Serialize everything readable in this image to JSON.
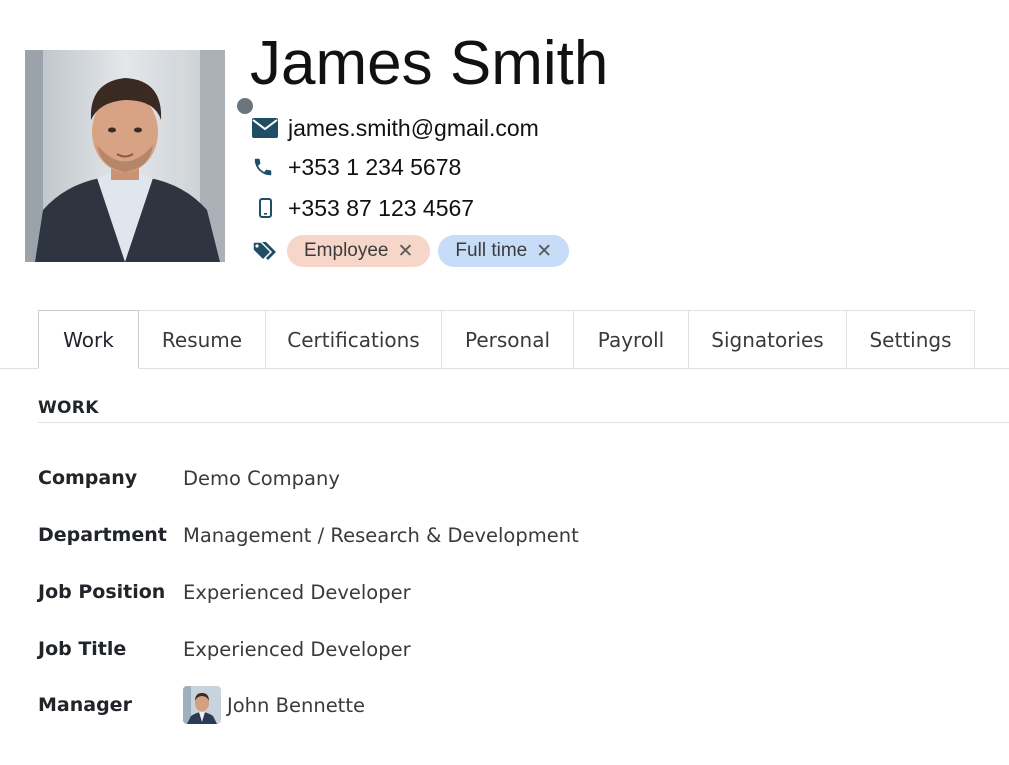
{
  "employee": {
    "name": "James Smith",
    "email": "james.smith@gmail.com",
    "work_phone": "+353 1 234 5678",
    "mobile_phone": "+353 87 123 4567",
    "tags": [
      {
        "label": "Employee",
        "remove": "✕",
        "color": "#f6d6c9"
      },
      {
        "label": "Full time",
        "remove": "✕",
        "color": "#c6dcf7"
      }
    ],
    "presence_color": "#6c757d"
  },
  "icons": {
    "email": "envelope-icon",
    "phone": "phone-icon",
    "mobile": "mobile-phone-icon",
    "tags": "tags-icon",
    "icon_color": "#1f4e66"
  },
  "tabs": [
    "Work",
    "Resume",
    "Certifications",
    "Personal",
    "Payroll",
    "Signatories",
    "Settings"
  ],
  "active_tab": "Work",
  "work": {
    "section_title": "WORK",
    "fields": {
      "company": {
        "label": "Company",
        "value": "Demo Company"
      },
      "department": {
        "label": "Department",
        "value": "Management / Research & Development"
      },
      "job_position": {
        "label": "Job Position",
        "value": "Experienced Developer"
      },
      "job_title": {
        "label": "Job Title",
        "value": "Experienced Developer"
      },
      "manager": {
        "label": "Manager",
        "value": "John Bennette"
      }
    }
  }
}
